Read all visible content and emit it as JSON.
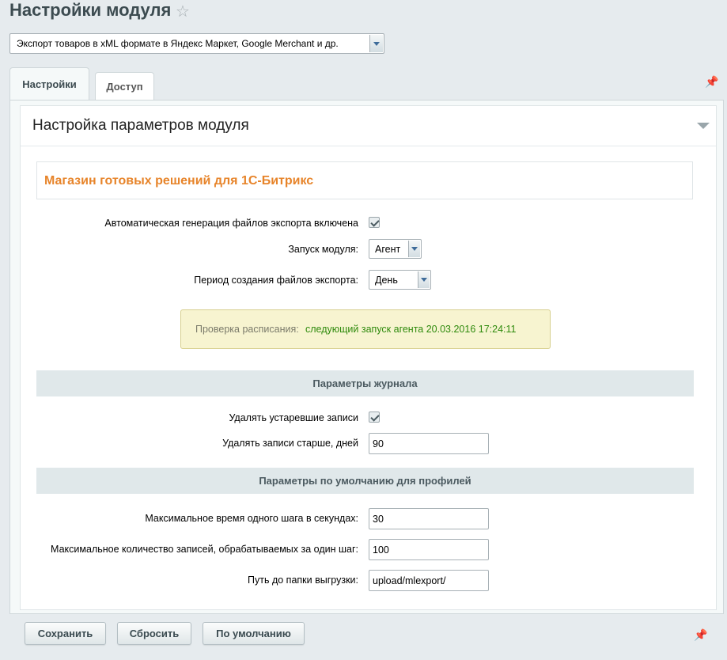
{
  "header": {
    "title": "Настройки модуля",
    "favorite_icon": "star-icon"
  },
  "module_select": {
    "value": "Экспорт товаров в xML формате в Яндекс Маркет, Google Merchant и др."
  },
  "tabs": [
    {
      "label": "Настройки",
      "active": true
    },
    {
      "label": "Доступ",
      "active": false
    }
  ],
  "section": {
    "title": "Настройка параметров модуля",
    "shop_link": "Магазин готовых решений для 1С-Битрикс"
  },
  "settings": {
    "auto_generation_label": "Автоматическая генерация файлов экспорта включена",
    "auto_generation_checked": true,
    "launch_label": "Запуск модуля:",
    "launch_value": "Агент",
    "period_label": "Период создания файлов экспорта:",
    "period_value": "День"
  },
  "notice": {
    "label": "Проверка расписания:",
    "value": "следующий запуск агента 20.03.2016 17:24:11"
  },
  "journal": {
    "header": "Параметры журнала",
    "delete_old_label": "Удалять устаревшие записи",
    "delete_old_checked": true,
    "delete_older_label": "Удалять записи старше, дней",
    "delete_older_value": "90"
  },
  "profiles": {
    "header": "Параметры по умолчанию для профилей",
    "max_time_label": "Максимальное время одного шага в секундах:",
    "max_time_value": "30",
    "max_records_label": "Максимальное количество записей, обрабатываемых за один шаг:",
    "max_records_value": "100",
    "path_label": "Путь до папки выгрузки:",
    "path_value": "upload/mlexport/"
  },
  "buttons": {
    "save": "Сохранить",
    "reset": "Сбросить",
    "default": "По умолчанию"
  },
  "colors": {
    "accent_orange": "#e7842a",
    "notice_green": "#2e8a0c"
  }
}
